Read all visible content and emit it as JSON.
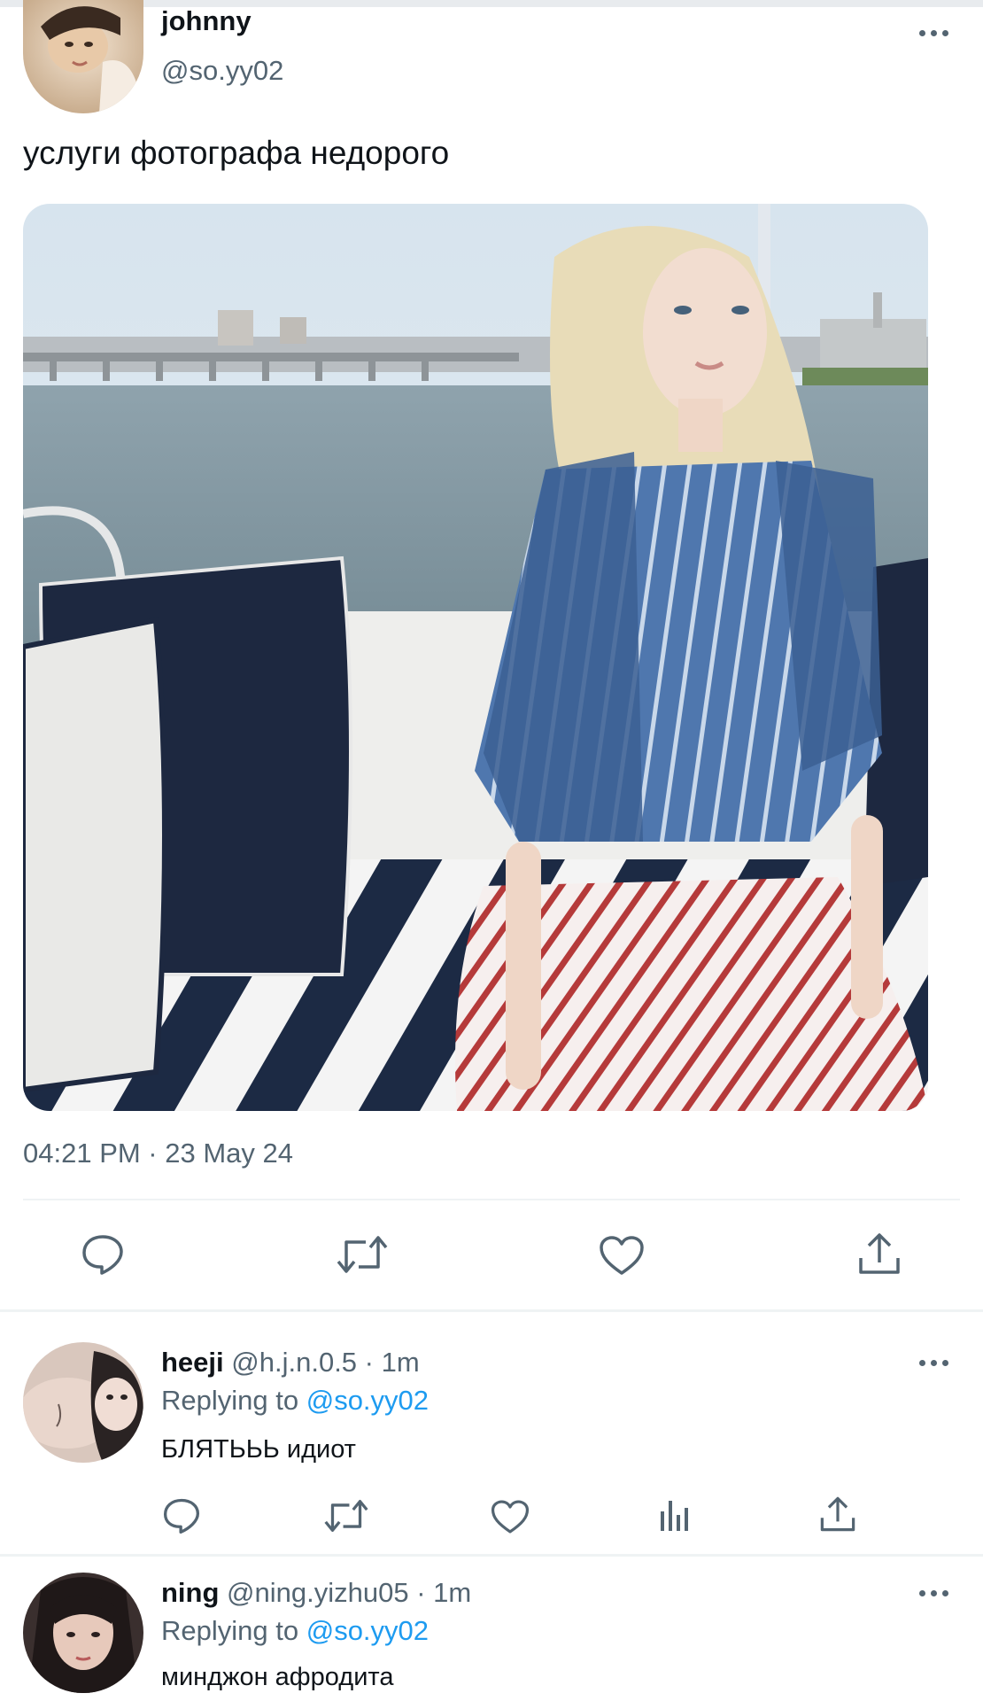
{
  "tweet": {
    "author_name": "johnny",
    "author_handle": "@so.yy02",
    "text": "услуги фотографа недорого",
    "timestamp": "04:21 PM · 23 May 24",
    "actions": [
      "reply-icon",
      "retweet-icon",
      "like-icon",
      "share-icon"
    ]
  },
  "replies": [
    {
      "name": "heeji",
      "meta": "@h.j.n.0.5 · 1m",
      "replying_prefix": "Replying to",
      "replying_handle": "@so.yy02",
      "text": "БЛЯТЬЬЬ идиот",
      "actions": [
        "reply-icon",
        "retweet-icon",
        "like-icon",
        "views-icon",
        "share-icon"
      ]
    },
    {
      "name": "ning",
      "meta": "@ning.yizhu05 · 1m",
      "replying_prefix": "Replying to",
      "replying_handle": "@so.yy02",
      "text": "минджон афродита"
    }
  ],
  "colors": {
    "text": "#0f1419",
    "secondary": "#536471",
    "link": "#1d9bf0",
    "divider": "#eff3f4"
  }
}
